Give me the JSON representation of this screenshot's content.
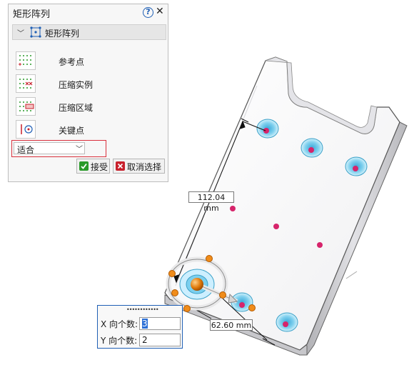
{
  "panel": {
    "title": "矩形阵列",
    "help_icon": "question-circle-icon",
    "section_label": "矩形阵列",
    "options": [
      {
        "label": "参考点",
        "icon": "reference-point-grid-icon"
      },
      {
        "label": "压缩实例",
        "icon": "suppress-instances-icon"
      },
      {
        "label": "压缩区域",
        "icon": "suppress-region-icon"
      },
      {
        "label": "关键点",
        "icon": "key-point-icon"
      }
    ],
    "fit_value": "适合",
    "accept_label": "接受",
    "cancel_label": "取消选择"
  },
  "dimensions": {
    "length": "112.04 mm",
    "spacing": "62.60 mm"
  },
  "counts": {
    "x_label": "X 向个数:",
    "x_value": "3",
    "y_label": "Y 向个数:",
    "y_value": "2"
  },
  "colors": {
    "accept": "#2a9a2a",
    "cancel": "#c8202c",
    "highlight": "#d9303c",
    "accent": "#1f5fb5"
  }
}
